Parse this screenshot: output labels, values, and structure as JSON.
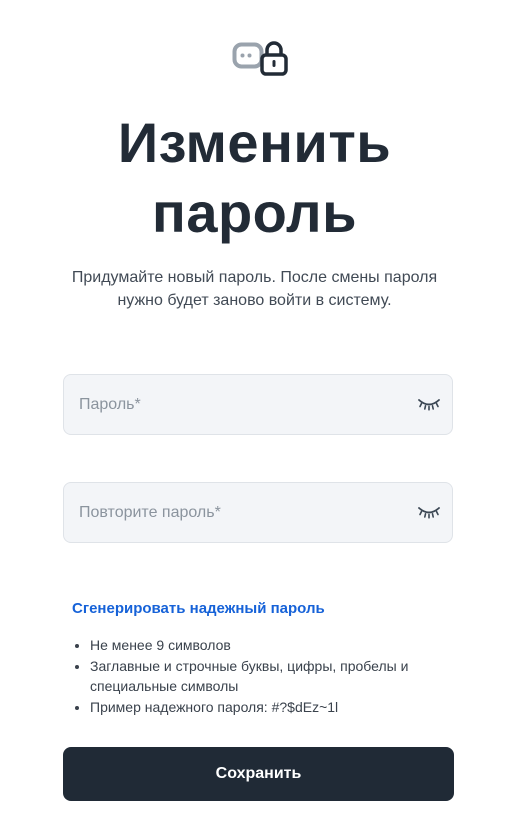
{
  "logo": {
    "icon": "chat-lock-icon"
  },
  "header": {
    "title_line1": "Изменить",
    "title_line2": "пароль",
    "subtitle_line1": "Придумайте новый пароль. После смены пароля",
    "subtitle_line2": "нужно будет заново войти в систему."
  },
  "form": {
    "password": {
      "placeholder": "Пароль*",
      "value": "",
      "toggle_icon": "eye-closed-icon"
    },
    "confirm_password": {
      "placeholder": "Повторите пароль*",
      "value": "",
      "toggle_icon": "eye-closed-icon"
    },
    "generate_link": "Сгенерировать надежный пароль",
    "rules": [
      "Не менее 9 символов",
      "Заглавные и строчные буквы, цифры, пробелы и специальные символы",
      "Пример надежного пароля: #?$dEz~1l"
    ],
    "save_label": "Сохранить"
  },
  "colors": {
    "primary_dark": "#202a36",
    "link_blue": "#1662d8",
    "input_bg": "#f3f5f8",
    "icon_gray": "#9aa3ad"
  }
}
